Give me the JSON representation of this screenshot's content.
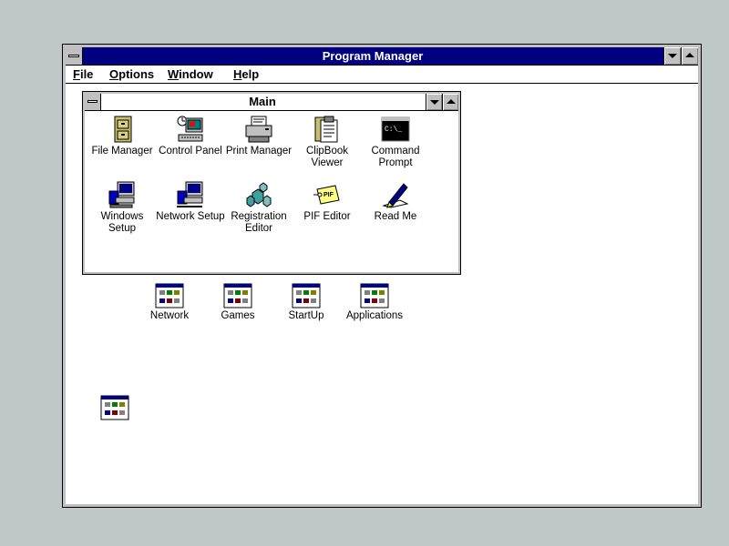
{
  "window": {
    "title": "Program Manager"
  },
  "menu": [
    {
      "accel": "F",
      "rest": "ile"
    },
    {
      "accel": "O",
      "rest": "ptions"
    },
    {
      "accel": "W",
      "rest": "indow"
    },
    {
      "accel": "H",
      "rest": "elp"
    }
  ],
  "main_group": {
    "title": "Main",
    "items": [
      {
        "label": "File Manager",
        "icon": "file-cabinet-icon"
      },
      {
        "label": "Control Panel",
        "icon": "control-panel-icon"
      },
      {
        "label": "Print Manager",
        "icon": "printer-icon"
      },
      {
        "label": "ClipBook\nViewer",
        "icon": "clipbook-icon"
      },
      {
        "label": "Command\nPrompt",
        "icon": "command-prompt-icon",
        "icon_text": "C:\\_"
      },
      {
        "label": "Windows\nSetup",
        "icon": "windows-setup-icon"
      },
      {
        "label": "Network Setup",
        "icon": "network-setup-icon"
      },
      {
        "label": "Registration\nEditor",
        "icon": "registration-editor-icon"
      },
      {
        "label": "PIF Editor",
        "icon": "pif-editor-icon",
        "icon_text": "PIF"
      },
      {
        "label": "Read Me",
        "icon": "read-me-icon"
      }
    ]
  },
  "minimized_groups": [
    {
      "label": "Network",
      "icon": "program-group-icon"
    },
    {
      "label": "Games",
      "icon": "program-group-icon"
    },
    {
      "label": "StartUp",
      "icon": "program-group-icon"
    },
    {
      "label": "Applications",
      "icon": "program-group-icon"
    },
    {
      "label": "",
      "icon": "program-group-icon"
    }
  ],
  "colors": {
    "title_active": "#000080",
    "desktop": "#c0c7c8",
    "window_face": "#c0c0c0"
  }
}
